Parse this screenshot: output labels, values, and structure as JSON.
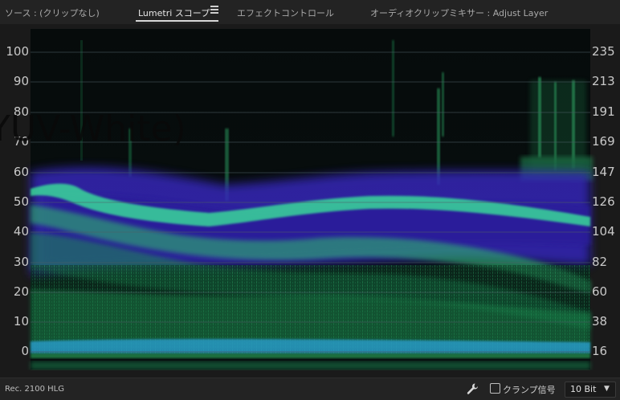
{
  "tabs": [
    {
      "label": "ソース : (クリップなし)",
      "active": false
    },
    {
      "label": "Lumetri スコープ",
      "active": true
    },
    {
      "label": "エフェクトコントロール",
      "active": false
    },
    {
      "label": "オーディオクリップミキサー : Adjust Layer",
      "active": false
    }
  ],
  "scope": {
    "left_axis": [
      "100",
      "90",
      "80",
      "70",
      "60",
      "50",
      "40",
      "30",
      "20",
      "10",
      "0"
    ],
    "right_axis": [
      "235",
      "213",
      "191",
      "169",
      "147",
      "126",
      "104",
      "82",
      "60",
      "38",
      "16"
    ],
    "overlay_text": "YUV-White)",
    "colors": {
      "background": "#050a0a",
      "trace_green": "#2fd27a",
      "trace_blue": "#3a2fd0",
      "gridline": "#4d5f66"
    }
  },
  "footer": {
    "color_space": "Rec. 2100 HLG",
    "settings_icon": "wrench-icon",
    "clamp_label": "クランプ信号",
    "clamp_checked": false,
    "bit_depth": "10 Bit"
  }
}
